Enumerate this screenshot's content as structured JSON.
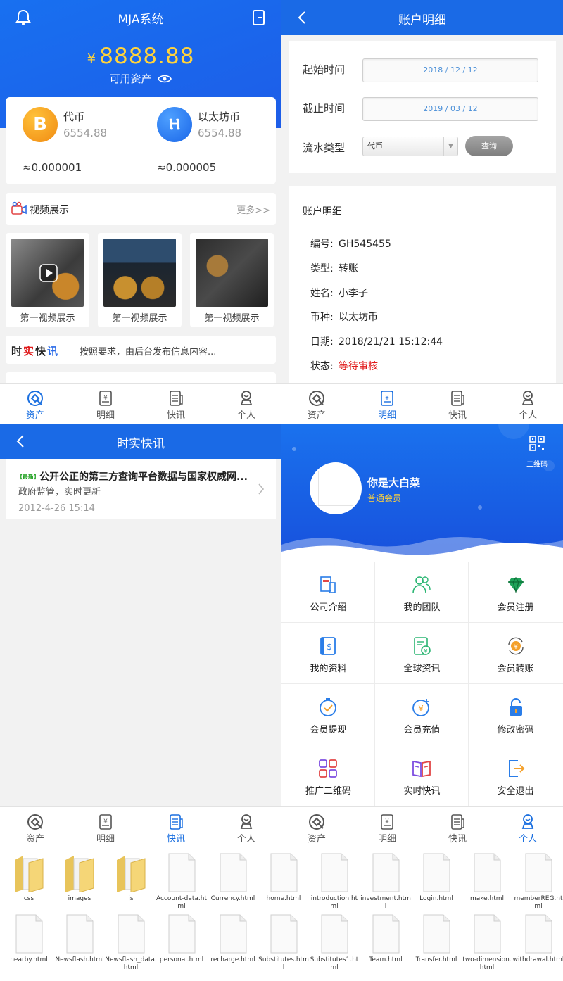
{
  "tabs": [
    {
      "label": "资产",
      "icon": "asset-icon"
    },
    {
      "label": "明细",
      "icon": "detail-icon"
    },
    {
      "label": "快讯",
      "icon": "news-icon"
    },
    {
      "label": "个人",
      "icon": "person-icon"
    }
  ],
  "colors": {
    "accent": "#1a6fe0",
    "gold": "#ffd33c",
    "alert": "#e0191a"
  },
  "assets": {
    "title": "MJA系统",
    "currency_symbol": "¥",
    "amount": "8888.88",
    "available_label": "可用资产",
    "coins": [
      {
        "name": "代币",
        "value": "6554.88",
        "approx": "≈0.000001",
        "icon": "bitcoin-icon"
      },
      {
        "name": "以太坊币",
        "value": "6554.88",
        "approx": "≈0.000005",
        "icon": "ethereum-icon"
      }
    ],
    "video_section": {
      "title": "视频展示",
      "more": "更多>>"
    },
    "videos": [
      {
        "caption": "第一视频展示"
      },
      {
        "caption": "第一视频展示"
      },
      {
        "caption": "第一视频展示"
      }
    ],
    "news_logo": [
      "时",
      "实",
      "快",
      "讯"
    ],
    "news_text": "按照要求，由后台发布信息内容..."
  },
  "detail": {
    "title": "账户明细",
    "form": {
      "start_label": "起始时间",
      "start_value": "2018 / 12 / 12",
      "end_label": "截止时间",
      "end_value": "2019 / 03 / 12",
      "type_label": "流水类型",
      "type_value": "代币",
      "query_button": "查询"
    },
    "section_title": "账户明细",
    "rows": [
      {
        "key": "编号:",
        "value": "GH545455"
      },
      {
        "key": "类型:",
        "value": "转账"
      },
      {
        "key": "姓名:",
        "value": "小李子"
      },
      {
        "key": "币种:",
        "value": "以太坊币"
      },
      {
        "key": "日期:",
        "value": "2018/21/21 15:12:44"
      },
      {
        "key": "状态:",
        "value": "等待审核"
      }
    ]
  },
  "news": {
    "title": "时实快讯",
    "item": {
      "badge": "【最新】",
      "headline": "公开公正的第三方查询平台数据与国家权威网...",
      "summary": "政府监管，实时更新",
      "date": "2012-4-26 15:14"
    }
  },
  "personal": {
    "qr_label": "二维码",
    "user_name": "你是大白菜",
    "user_level": "普通会员",
    "menu": [
      {
        "label": "公司介绍",
        "icon": "company-icon"
      },
      {
        "label": "我的团队",
        "icon": "team-icon"
      },
      {
        "label": "会员注册",
        "icon": "diamond-icon"
      },
      {
        "label": "我的资料",
        "icon": "profile-icon"
      },
      {
        "label": "全球资讯",
        "icon": "global-news-icon"
      },
      {
        "label": "会员转账",
        "icon": "transfer-icon"
      },
      {
        "label": "会员提现",
        "icon": "withdraw-icon"
      },
      {
        "label": "会员充值",
        "icon": "recharge-icon"
      },
      {
        "label": "修改密码",
        "icon": "lock-icon"
      },
      {
        "label": "推广二维码",
        "icon": "qrcode-icon"
      },
      {
        "label": "实时快讯",
        "icon": "book-icon"
      },
      {
        "label": "安全退出",
        "icon": "logout-icon"
      }
    ]
  },
  "files": [
    {
      "name": "css",
      "type": "folder"
    },
    {
      "name": "images",
      "type": "folder"
    },
    {
      "name": "js",
      "type": "folder"
    },
    {
      "name": "Account-data.html",
      "type": "file"
    },
    {
      "name": "Currency.html",
      "type": "file"
    },
    {
      "name": "home.html",
      "type": "file"
    },
    {
      "name": "introduction.html",
      "type": "file"
    },
    {
      "name": "investment.html",
      "type": "file"
    },
    {
      "name": "Login.html",
      "type": "file"
    },
    {
      "name": "make.html",
      "type": "file"
    },
    {
      "name": "memberREG.html",
      "type": "file"
    },
    {
      "name": "nearby.html",
      "type": "file"
    },
    {
      "name": "Newsflash.html",
      "type": "file"
    },
    {
      "name": "Newsflash_data.html",
      "type": "file"
    },
    {
      "name": "personal.html",
      "type": "file"
    },
    {
      "name": "recharge.html",
      "type": "file"
    },
    {
      "name": "Substitutes.html",
      "type": "file"
    },
    {
      "name": "Substitutes1.html",
      "type": "file"
    },
    {
      "name": "Team.html",
      "type": "file"
    },
    {
      "name": "Transfer.html",
      "type": "file"
    },
    {
      "name": "two-dimension.html",
      "type": "file"
    },
    {
      "name": "withdrawal.html",
      "type": "file"
    }
  ]
}
